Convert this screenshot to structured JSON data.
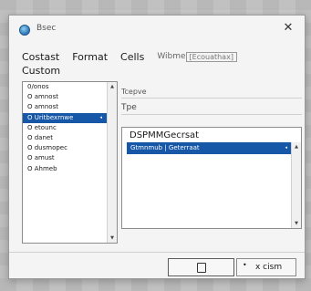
{
  "dialog": {
    "title": "Bsec",
    "close_glyph": "✕"
  },
  "tabs": [
    {
      "label": "Costast"
    },
    {
      "label": "Format"
    },
    {
      "label": "Cells"
    },
    {
      "label": "Wibme"
    },
    {
      "label": "[Ecouathax]"
    }
  ],
  "category": {
    "title": "Custom",
    "items": [
      {
        "label": "0/onos"
      },
      {
        "label": "O amnost"
      },
      {
        "label": "O amnost"
      },
      {
        "label": "O Uritbexrnwe",
        "selected": true
      },
      {
        "label": "O etounc"
      },
      {
        "label": "O danet"
      },
      {
        "label": "O dusmopec"
      },
      {
        "label": "O amust"
      },
      {
        "label": "O Ahmeb"
      }
    ]
  },
  "type_section": {
    "label1": "Tcepve",
    "label2": "Tpe",
    "current_value": "DSPMMGecrsat",
    "selected_item": "Gtmnmub | Geterraat"
  },
  "buttons": {
    "ok_icon": "square-icon",
    "cancel_dot": "•",
    "cancel_label": "x cism"
  },
  "icons": {
    "scroll_up": "▲",
    "scroll_down": "▼",
    "item_arrow": "◂"
  },
  "colors": {
    "selection": "#1657a8",
    "dialog_bg": "#f4f4f4"
  }
}
